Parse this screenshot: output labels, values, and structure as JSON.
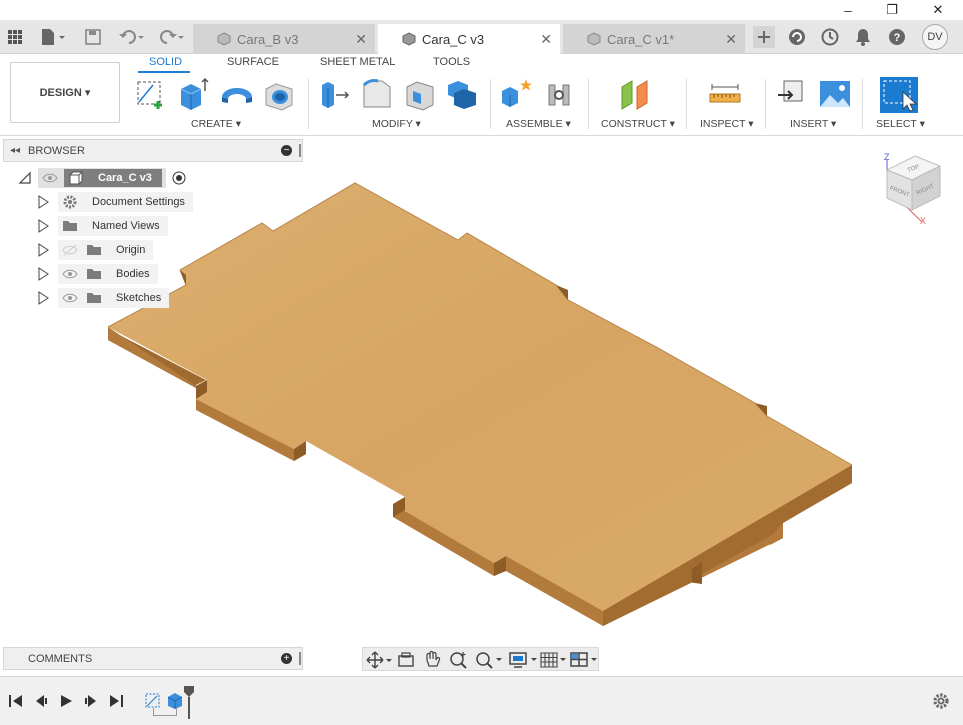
{
  "window": {
    "controls": [
      {
        "name": "minimize",
        "glyph": "–"
      },
      {
        "name": "restore",
        "glyph": "❐"
      },
      {
        "name": "close",
        "glyph": "✕"
      }
    ]
  },
  "tabs": [
    {
      "label": "Cara_B v3",
      "active": false
    },
    {
      "label": "Cara_C v3",
      "active": true
    },
    {
      "label": "Cara_C v1*",
      "active": false
    }
  ],
  "user": {
    "initials": "DV"
  },
  "ribbon": {
    "workspace": "DESIGN ▾",
    "tabs": [
      "SOLID",
      "SURFACE",
      "SHEET METAL",
      "TOOLS"
    ],
    "groups": [
      {
        "label": "CREATE ▾"
      },
      {
        "label": "MODIFY ▾"
      },
      {
        "label": "ASSEMBLE ▾"
      },
      {
        "label": "CONSTRUCT ▾"
      },
      {
        "label": "INSPECT ▾"
      },
      {
        "label": "INSERT ▾"
      },
      {
        "label": "SELECT ▾"
      }
    ]
  },
  "browser": {
    "title": "BROWSER",
    "root": "Cara_C v3",
    "items": [
      {
        "label": "Document Settings",
        "icon": "gear-icon"
      },
      {
        "label": "Named Views",
        "icon": "folder-icon"
      },
      {
        "label": "Origin",
        "icon": "folder-icon"
      },
      {
        "label": "Bodies",
        "icon": "folder-icon"
      },
      {
        "label": "Sketches",
        "icon": "folder-icon"
      }
    ]
  },
  "comments": {
    "title": "COMMENTS"
  },
  "viewcube": {
    "top": "TOP",
    "front": "FRONT",
    "right": "RIGHT",
    "axis_z": "Z",
    "axis_x": "X"
  },
  "colors": {
    "accent": "#1b7bd1",
    "wood": "#d9a866",
    "wood_edge": "#c48d4f",
    "wood_side": "#a77035"
  }
}
